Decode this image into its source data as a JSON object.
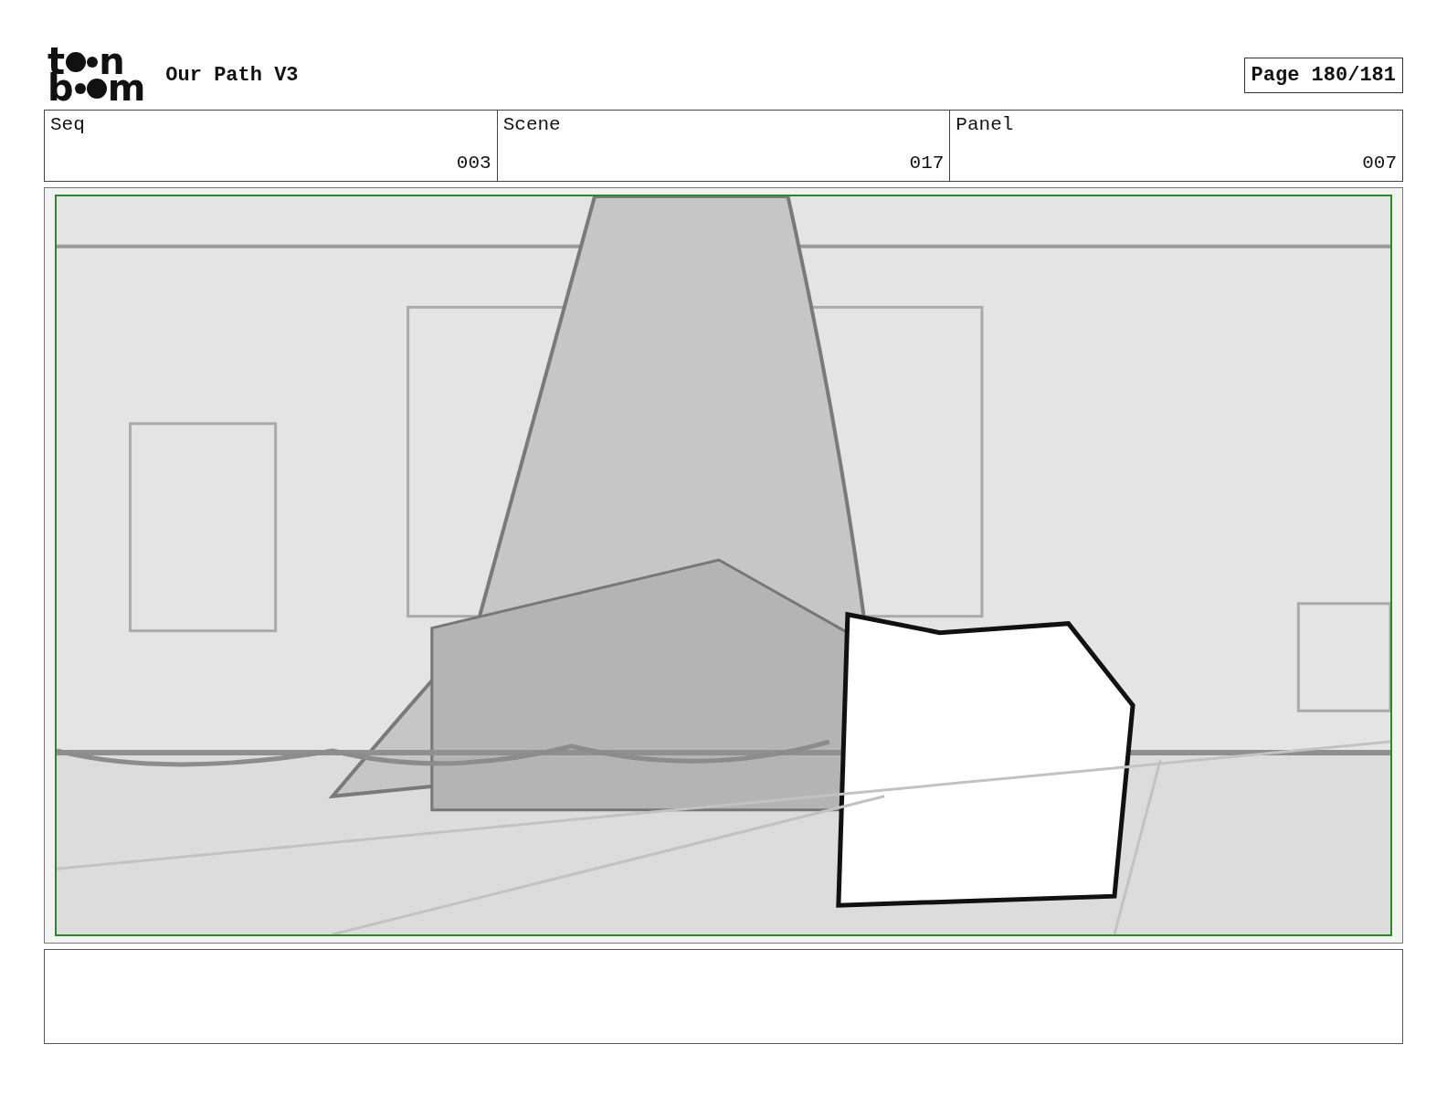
{
  "header": {
    "logo_lines": [
      [
        "t",
        "n"
      ],
      [
        "b",
        "m"
      ]
    ],
    "title": "Our Path V3",
    "page": "Page 180/181"
  },
  "info_table": {
    "columns": [
      "Seq",
      "Scene",
      "Panel"
    ],
    "row": [
      "003",
      "017",
      "007"
    ]
  }
}
